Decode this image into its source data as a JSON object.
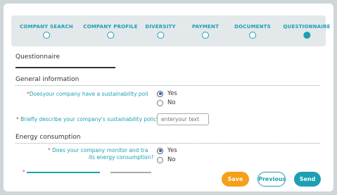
{
  "steps": [
    {
      "label": "COMPANY SEARCH",
      "active": false
    },
    {
      "label": "COMPANY PROFILE",
      "active": false
    },
    {
      "label": "DIVERSITY",
      "active": false
    },
    {
      "label": "PAYMENT",
      "active": false
    },
    {
      "label": "DOCUMENTS",
      "active": false
    },
    {
      "label": "QUESTIONNAIRE",
      "active": true
    }
  ],
  "page_title": "Questionnaire",
  "sections": {
    "general": {
      "title": "General information",
      "q1": {
        "required_mark": "*",
        "text": "Doesyour company have a sustainability poli",
        "options": [
          "Yes",
          "No"
        ],
        "selected": "Yes"
      },
      "q2": {
        "required_mark": "*",
        "text": " Briefly describe your company's sustainability policy",
        "placeholder": "enteryour text"
      }
    },
    "energy": {
      "title": "Energy consumption",
      "q1": {
        "required_mark": "*",
        "line1": " Does your company monitor and tra",
        "line2": "its energy consumption?",
        "options": [
          "Yes",
          "No"
        ],
        "selected": "Yes"
      }
    }
  },
  "partial_required_mark": "*",
  "buttons": {
    "save": "Save",
    "previous": "Previous",
    "send": "Send"
  },
  "colors": {
    "accent": "#1d9fb3",
    "save": "#f5a018",
    "required": "#e0455f",
    "background": "#cfd6da"
  }
}
